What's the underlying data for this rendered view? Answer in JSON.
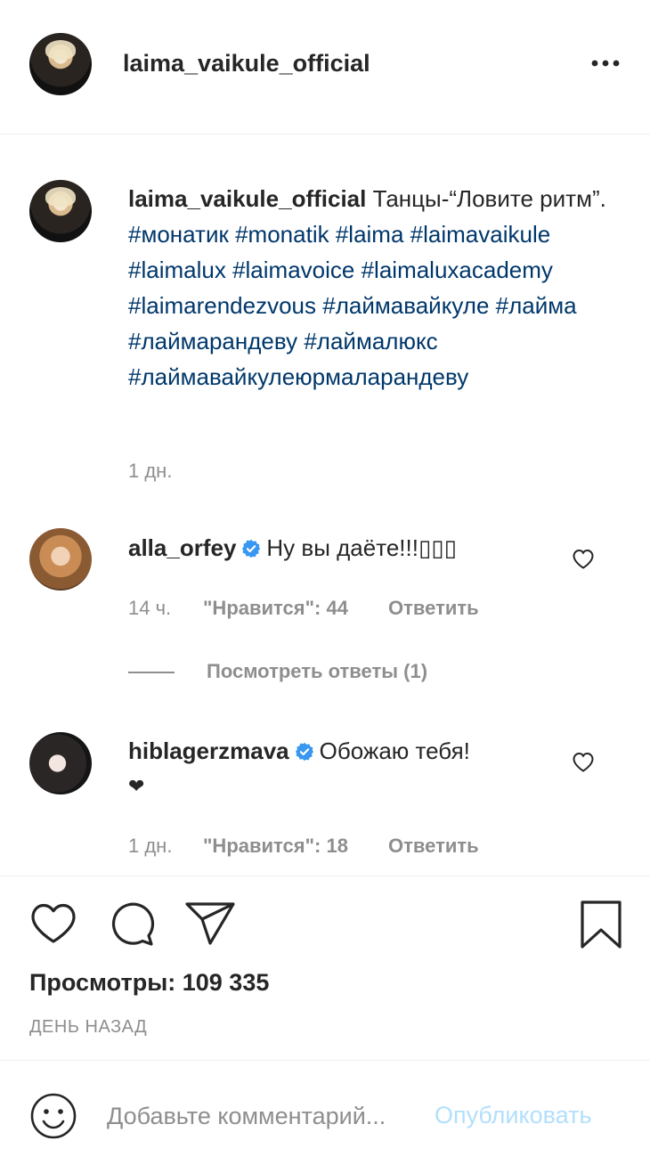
{
  "header": {
    "username": "laima_vaikule_official",
    "more_icon": "more-horizontal-icon"
  },
  "post": {
    "username": "laima_vaikule_official",
    "caption_text": " Танцы-“Ловите ритм”. ",
    "hashtags": [
      "#монатик",
      "#monatik",
      "#laima",
      "#laimavaikule",
      "#laimalux",
      "#laimavoice",
      "#laimaluxacademy",
      "#laimarendezvous",
      "#лаймавайкуле",
      "#лайма",
      "#лаймарандеву",
      "#лаймалюкс",
      "#лаймавайкулеюрмаларандеву"
    ],
    "time": "1 дн."
  },
  "comments": [
    {
      "username": "alla_orfey",
      "verified": true,
      "text": "Ну вы даёте!!!▯▯▯",
      "time": "14 ч.",
      "likes": "\"Нравится\": 44",
      "reply": "Ответить",
      "view_replies": "Посмотреть ответы (1)"
    },
    {
      "username": "hiblagerzmava",
      "verified": true,
      "text": "Обожаю тебя!",
      "text_line2": "❤",
      "time": "1 дн.",
      "likes": "\"Нравится\": 18",
      "reply": "Ответить"
    }
  ],
  "actions": {
    "icons": [
      "heart-icon",
      "comment-icon",
      "share-icon",
      "bookmark-icon"
    ],
    "views": "Просмотры: 109 335",
    "posted_ago": "ДЕНЬ НАЗАД"
  },
  "comment_box": {
    "placeholder": "Добавьте комментарий...",
    "post_label": "Опубликовать",
    "post_color": "#b2dffc",
    "emoji_icon": "emoji-icon"
  },
  "colors": {
    "hashtag": "#00376b",
    "verified": "#3897f0",
    "muted": "#8e8e8e"
  }
}
